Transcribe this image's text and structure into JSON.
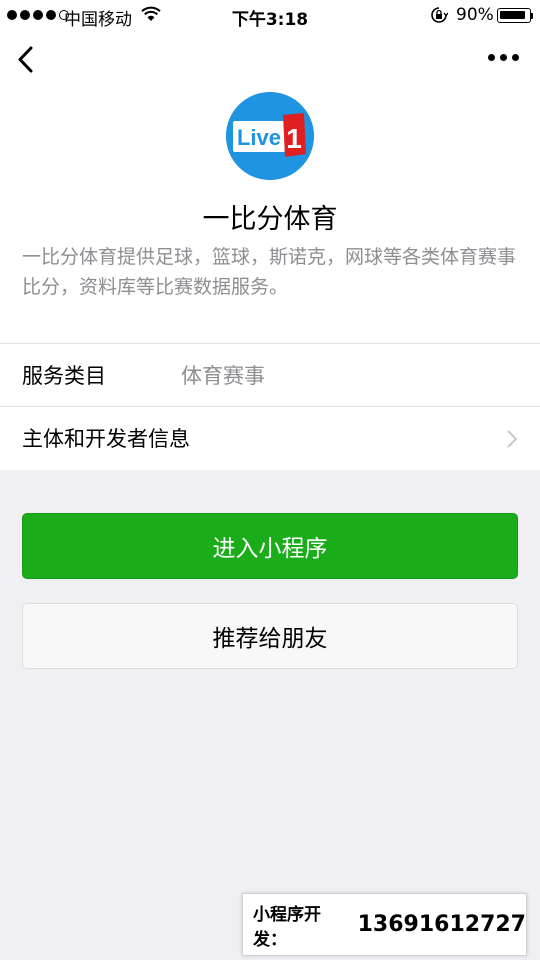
{
  "status_bar": {
    "carrier": "中国移动",
    "time": "下午3:18",
    "battery_percent": "90%",
    "battery_level": 0.9,
    "signal_bars": 4,
    "signal_total": 5
  },
  "nav": {
    "back_icon": "chevron-left-icon",
    "more_icon": "more-dots-icon"
  },
  "app": {
    "logo_text": "Live",
    "logo_number": "1",
    "name": "一比分体育",
    "description": "一比分体育提供足球，篮球，斯诺克，网球等各类体育赛事比分，资料库等比赛数据服务。"
  },
  "info_rows": {
    "category_label": "服务类目",
    "category_value": "体育赛事",
    "developer_label": "主体和开发者信息"
  },
  "buttons": {
    "enter_label": "进入小程序",
    "share_label": "推荐给朋友"
  },
  "promo": {
    "label": "小程序开发：",
    "phone": "13691612727"
  },
  "colors": {
    "primary_green": "#1aad19",
    "logo_blue": "#1f94e0",
    "logo_red": "#e02020",
    "secondary_text": "#8e8e93",
    "page_background": "#efeff4"
  }
}
